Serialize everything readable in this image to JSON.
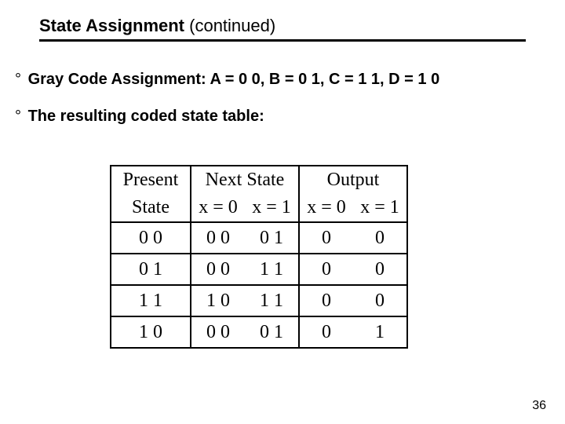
{
  "title": {
    "main": "State Assignment",
    "cont": " (continued)"
  },
  "bullets": {
    "b1": "Gray Code Assignment: A = 0 0, B = 0 1, C = 1 1, D = 1 0",
    "b2": "The resulting coded state table:"
  },
  "table_headers": {
    "present1": "Present",
    "present2": "State",
    "next1": "Next State",
    "out1": "Output",
    "x0": "x = 0",
    "x1": "x = 1"
  },
  "chart_data": {
    "type": "table",
    "title": "Coded State Table",
    "columns": [
      "Present State",
      "Next State x=0",
      "Next State x=1",
      "Output x=0",
      "Output x=1"
    ],
    "rows": [
      {
        "present": "0 0",
        "next_x0": "0 0",
        "next_x1": "0 1",
        "out_x0": "0",
        "out_x1": "0"
      },
      {
        "present": "0 1",
        "next_x0": "0 0",
        "next_x1": "1 1",
        "out_x0": "0",
        "out_x1": "0"
      },
      {
        "present": "1 1",
        "next_x0": "1 0",
        "next_x1": "1 1",
        "out_x0": "0",
        "out_x1": "0"
      },
      {
        "present": "1 0",
        "next_x0": "0 0",
        "next_x1": "0 1",
        "out_x0": "0",
        "out_x1": "1"
      }
    ]
  },
  "page_number": "36"
}
